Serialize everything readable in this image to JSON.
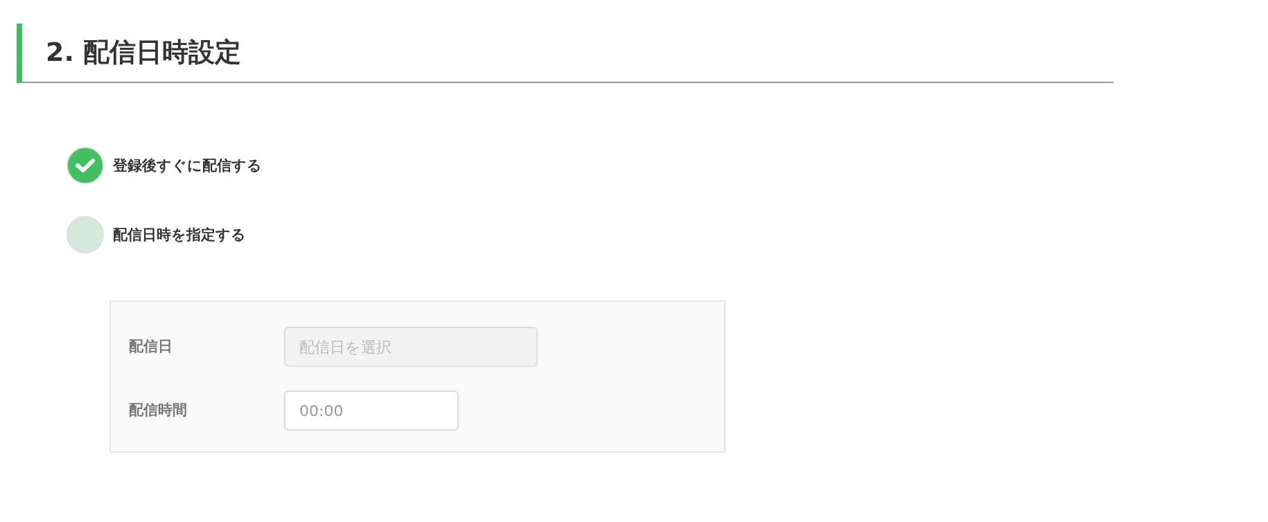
{
  "section": {
    "title": "2. 配信日時設定"
  },
  "options": [
    {
      "label": "登録後すぐに配信する",
      "selected": true
    },
    {
      "label": "配信日時を指定する",
      "selected": false
    }
  ],
  "schedule": {
    "date": {
      "label": "配信日",
      "placeholder": "配信日を選択",
      "disabled": true
    },
    "time": {
      "label": "配信時間",
      "value": "00:00",
      "disabled": false
    }
  }
}
